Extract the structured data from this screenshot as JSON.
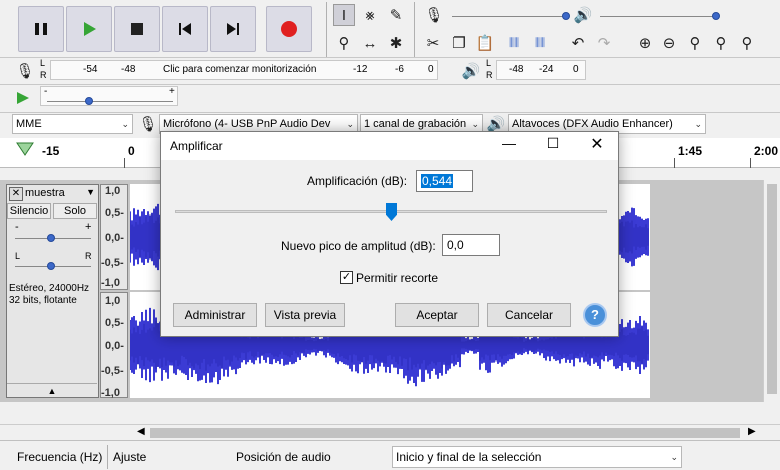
{
  "transport": {
    "meter_hint": "Clic para comenzar monitorización",
    "rec_scale": [
      "-54",
      "-48",
      "-12",
      "-6",
      "0"
    ],
    "play_scale": [
      "-48",
      "-24",
      "0"
    ],
    "meter_channels": [
      "L",
      "R"
    ]
  },
  "device": {
    "host": "MME",
    "microphone": "Micrófono (4- USB PnP Audio Dev",
    "channels": "1 canal de grabación",
    "speakers": "Altavoces (DFX Audio Enhancer)"
  },
  "ruler": {
    "ticks": [
      "-15",
      "0",
      "1:45",
      "2:00"
    ]
  },
  "track": {
    "name": "muestra",
    "mute": "Silencio",
    "solo": "Solo",
    "gain_min": "-",
    "gain_max": "+",
    "pan_left": "L",
    "pan_right": "R",
    "info_line1": "Estéreo, 24000Hz",
    "info_line2": "32 bits, flotante",
    "y_labels": [
      "1,0",
      "0,5-",
      "0,0-",
      "-0,5-",
      "-1,0"
    ],
    "y_labels2": [
      "1,0",
      "0,5-",
      "0,0-",
      "-0,5-",
      "-1,0"
    ]
  },
  "dialog": {
    "title": "Amplificar",
    "amp_label": "Amplificación (dB):",
    "amp_value": "0,544",
    "peak_label": "Nuevo pico de amplitud (dB):",
    "peak_value": "0,0",
    "clip_label": "Permitir recorte",
    "clip_checked": true,
    "btn_manage": "Administrar",
    "btn_preview": "Vista previa",
    "btn_ok": "Aceptar",
    "btn_cancel": "Cancelar",
    "help": "?",
    "amp_slider_fraction": 0.5
  },
  "bottom": {
    "rate": "Frecuencia (Hz)",
    "snap": "Ajuste",
    "pos": "Posición de audio",
    "sel_mode": "Inicio y final de la selección"
  },
  "colors": {
    "wave": "#3b3bd4",
    "wave_dark": "#2020a8",
    "record": "#e02020",
    "play": "#36a536",
    "accent": "#3c68c8"
  }
}
